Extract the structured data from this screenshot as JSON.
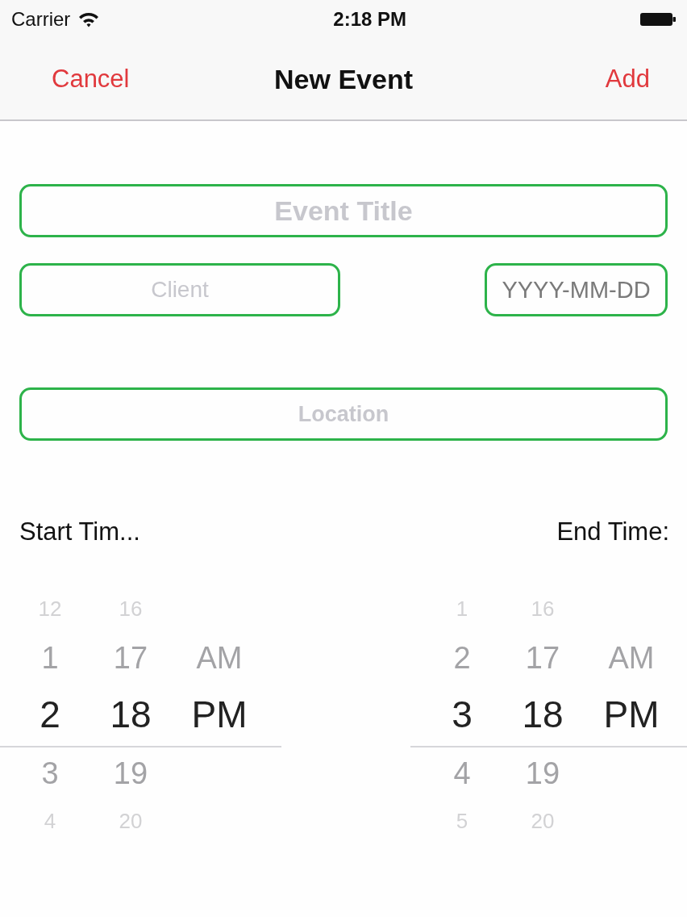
{
  "status_bar": {
    "carrier": "Carrier",
    "time": "2:18 PM"
  },
  "nav_bar": {
    "cancel": "Cancel",
    "title": "New Event",
    "add": "Add"
  },
  "title_field": {
    "placeholder": "Event Title"
  },
  "client_field": {
    "placeholder": "Client"
  },
  "date_field": {
    "value": "YYYY-MM-DD"
  },
  "location_field": {
    "placeholder": "Location"
  },
  "pickers": [
    {
      "label": "Start Tim...",
      "columns": [
        {
          "items": [
            {
              "text": "12",
              "selected": false
            },
            {
              "text": "1",
              "selected": false
            },
            {
              "text": "2",
              "selected": true
            },
            {
              "text": "3",
              "selected": false
            },
            {
              "text": "4",
              "selected": false
            }
          ]
        },
        {
          "items": [
            {
              "text": "16",
              "selected": false
            },
            {
              "text": "17",
              "selected": false
            },
            {
              "text": "18",
              "selected": true
            },
            {
              "text": "19",
              "selected": false
            },
            {
              "text": "20",
              "selected": false
            }
          ]
        },
        {
          "items": [
            {
              "text": "AM",
              "selected": false
            },
            {
              "text": "PM",
              "selected": true
            }
          ]
        }
      ]
    },
    {
      "label": "End Time:",
      "columns": [
        {
          "items": [
            {
              "text": "1",
              "selected": false
            },
            {
              "text": "2",
              "selected": false
            },
            {
              "text": "3",
              "selected": true
            },
            {
              "text": "4",
              "selected": false
            },
            {
              "text": "5",
              "selected": false
            }
          ]
        },
        {
          "items": [
            {
              "text": "16",
              "selected": false
            },
            {
              "text": "17",
              "selected": false
            },
            {
              "text": "18",
              "selected": true
            },
            {
              "text": "19",
              "selected": false
            },
            {
              "text": "20",
              "selected": false
            }
          ]
        },
        {
          "items": [
            {
              "text": "AM",
              "selected": false
            },
            {
              "text": "PM",
              "selected": true
            }
          ]
        }
      ]
    }
  ]
}
